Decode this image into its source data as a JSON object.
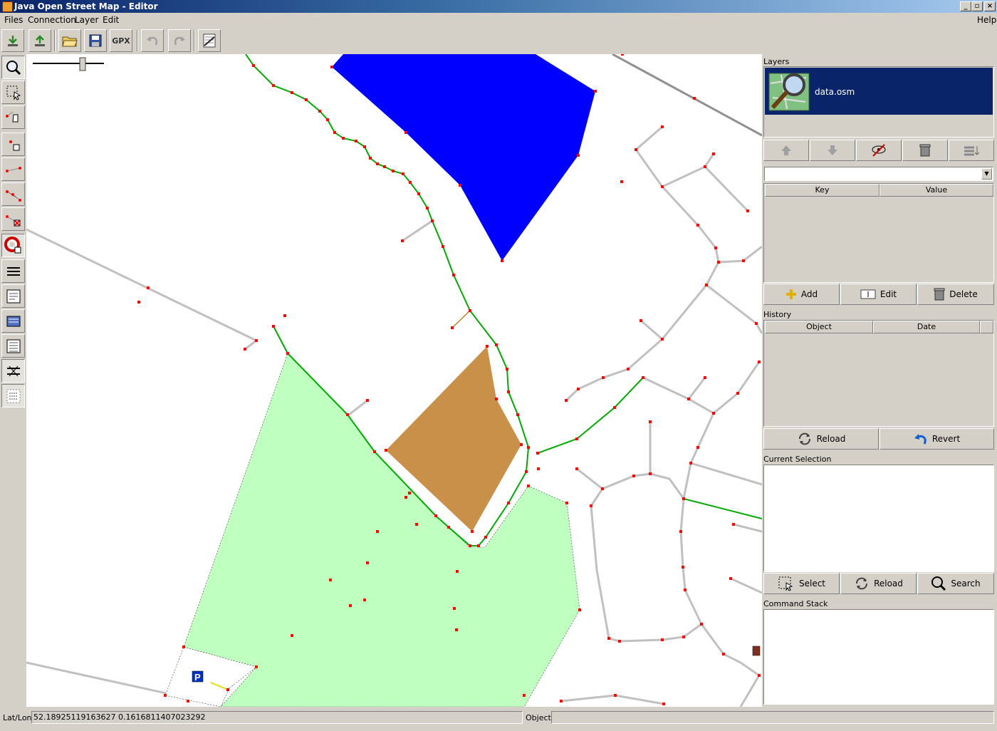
{
  "window": {
    "title": "Java Open Street Map - Editor"
  },
  "menu": {
    "files": "Files",
    "connection": "Connection",
    "layer": "Layer",
    "edit": "Edit",
    "help": "Help"
  },
  "toolbar": {
    "gpx_label": "GPX"
  },
  "layers": {
    "title": "Layers",
    "items": [
      {
        "name": "data.osm"
      }
    ]
  },
  "properties": {
    "key_header": "Key",
    "value_header": "Value",
    "add": "Add",
    "edit": "Edit",
    "delete": "Delete"
  },
  "history": {
    "title": "History",
    "object_header": "Object",
    "date_header": "Date",
    "reload": "Reload",
    "revert": "Revert"
  },
  "selection": {
    "title": "Current Selection",
    "select": "Select",
    "reload": "Reload",
    "search": "Search"
  },
  "command_stack": {
    "title": "Command Stack"
  },
  "statusbar": {
    "latlon_label": "Lat/Lon",
    "latlon_value": "52.18925119163627 0.1616811407023292",
    "object_label": "Object",
    "object_value": ""
  },
  "map": {
    "parking_label": "P",
    "colors": {
      "water": "#0000ff",
      "building": "#c89048",
      "park": "#bfffbf",
      "path": "#00aa00",
      "road": "#c0c0c0",
      "node": "#ff0000"
    }
  }
}
